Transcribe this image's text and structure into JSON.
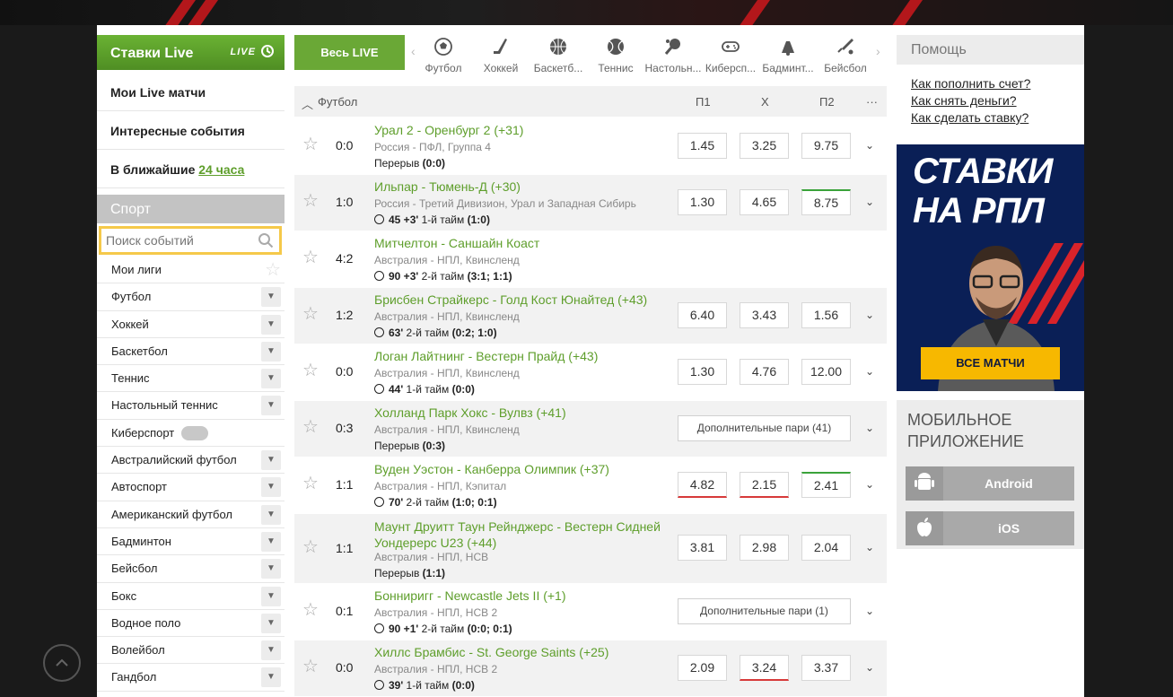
{
  "left": {
    "live_title": "Ставки Live",
    "live_badge": "LIVE",
    "menu": {
      "my_live": "Мои Live матчи",
      "interesting": "Интересные события",
      "nearest": "В ближайшие",
      "nearest_link": "24 часа"
    },
    "sport_head": "Спорт",
    "search_placeholder": "Поиск событий",
    "sports": [
      "Мои лиги",
      "Футбол",
      "Хоккей",
      "Баскетбол",
      "Теннис",
      "Настольный теннис",
      "Киберспорт",
      "Австралийский футбол",
      "Автоспорт",
      "Американский футбол",
      "Бадминтон",
      "Бейсбол",
      "Бокс",
      "Водное поло",
      "Волейбол",
      "Гандбол"
    ]
  },
  "center": {
    "all_live": "Весь LIVE",
    "sport_tabs": [
      "Футбол",
      "Хоккей",
      "Баскетб...",
      "Теннис",
      "Настольн...",
      "Киберсп...",
      "Бадминт...",
      "Бейсбол"
    ],
    "table_head": {
      "sport": "Футбол",
      "p1": "П1",
      "x": "Х",
      "p2": "П2",
      "more": "···"
    },
    "matches": [
      {
        "score": "0:0",
        "name": "Урал 2 - Оренбург 2 (+31)",
        "league": "Россия - ПФЛ, Группа 4",
        "status_text": "Перерыв",
        "status_score": "(0:0)",
        "p1": "1.45",
        "x": "3.25",
        "p2": "9.75"
      },
      {
        "score": "1:0",
        "name": "Ильпар - Тюмень-Д (+30)",
        "league": "Россия - Третий Дивизион, Урал и Западная Сибирь",
        "minute": "45 +3'",
        "status_text": "1-й тайм",
        "status_score": "(1:0)",
        "p1": "1.30",
        "x": "4.65",
        "p2": "8.75"
      },
      {
        "score": "4:2",
        "name": "Митчелтон - Саншайн Коаст",
        "league": "Австралия - НПЛ, Квинсленд",
        "minute": "90 +3'",
        "status_text": "2-й тайм",
        "status_score": "(3:1; 1:1)"
      },
      {
        "score": "1:2",
        "name": "Брисбен Страйкерс - Голд Кост Юнайтед (+43)",
        "league": "Австралия - НПЛ, Квинсленд",
        "minute": "63'",
        "status_text": "2-й тайм",
        "status_score": "(0:2; 1:0)",
        "p1": "6.40",
        "x": "3.43",
        "p2": "1.56"
      },
      {
        "score": "0:0",
        "name": "Логан Лайтнинг - Вестерн Прайд (+43)",
        "league": "Австралия - НПЛ, Квинсленд",
        "minute": "44'",
        "status_text": "1-й тайм",
        "status_score": "(0:0)",
        "p1": "1.30",
        "x": "4.76",
        "p2": "12.00"
      },
      {
        "score": "0:3",
        "name": "Холланд Парк Хокс - Вулвз (+41)",
        "league": "Австралия - НПЛ, Квинсленд",
        "status_text": "Перерыв",
        "status_score": "(0:3)",
        "extra": "Дополнительные пари",
        "extra_count": "(41)"
      },
      {
        "score": "1:1",
        "name": "Вуден Уэстон - Канберра Олимпик (+37)",
        "league": "Австралия - НПЛ, Кэпитал",
        "minute": "70'",
        "status_text": "2-й тайм",
        "status_score": "(1:0; 0:1)",
        "p1": "4.82",
        "x": "2.15",
        "p2": "2.41"
      },
      {
        "score": "1:1",
        "name": "Маунт Друитт Таун Рейнджерс - Вестерн Сидней Уондерерс U23 (+44)",
        "league": "Австралия - НПЛ, НСВ",
        "status_text": "Перерыв",
        "status_score": "(1:1)",
        "p1": "3.81",
        "x": "2.98",
        "p2": "2.04"
      },
      {
        "score": "0:1",
        "name": "Бонниригг - Newcastle Jets II (+1)",
        "league": "Австралия - НПЛ, НСВ 2",
        "minute": "90 +1'",
        "status_text": "2-й тайм",
        "status_score": "(0:0; 0:1)",
        "extra": "Дополнительные пари",
        "extra_count": "(1)"
      },
      {
        "score": "0:0",
        "name": "Хиллс Брамбис - St. George Saints (+25)",
        "league": "Австралия - НПЛ, НСВ 2",
        "minute": "39'",
        "status_text": "1-й тайм",
        "status_score": "(0:0)",
        "p1": "2.09",
        "x": "3.24",
        "p2": "3.37"
      }
    ]
  },
  "right": {
    "help_title": "Помощь",
    "help_links": [
      "Как пополнить счет?",
      "Как снять деньги?",
      "Как сделать ставку?"
    ],
    "banner_line1": "СТАВКИ",
    "banner_line2": "НА РПЛ",
    "banner_button": "ВСЕ МАТЧИ",
    "mobile_title_1": "МОБИЛЬНОЕ",
    "mobile_title_2": "ПРИЛОЖЕНИЕ",
    "android": "Android",
    "ios": "iOS"
  },
  "colors": {
    "accent": "#5e9e2b",
    "banner_bg": "#0a1f56",
    "banner_btn": "#f7b800",
    "search_border": "#f5c94a"
  }
}
